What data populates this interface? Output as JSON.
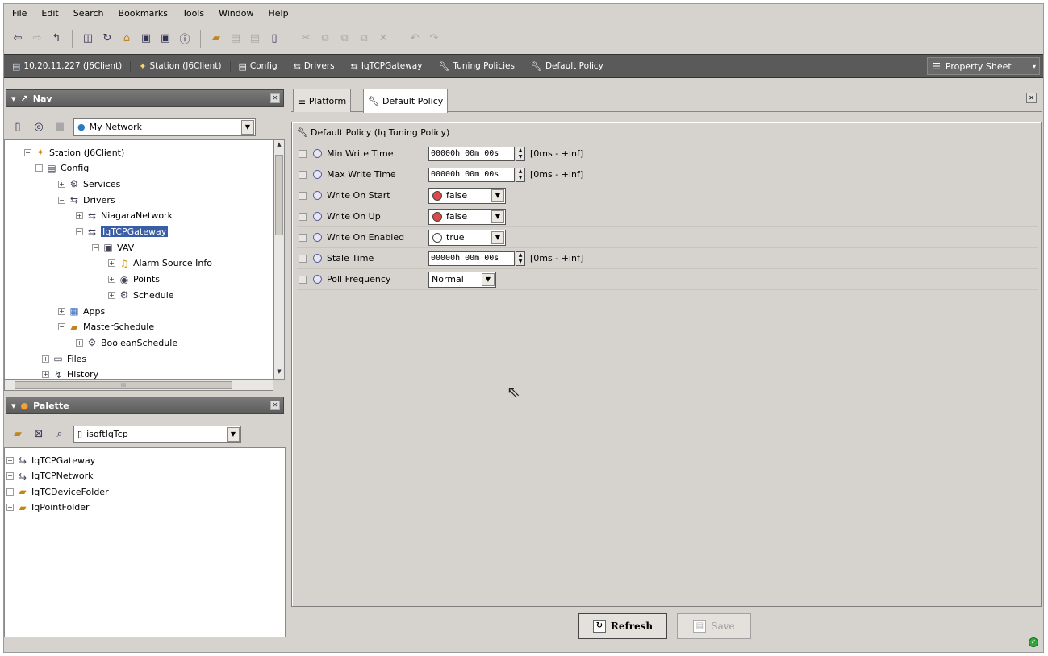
{
  "menu": [
    "File",
    "Edit",
    "Search",
    "Bookmarks",
    "Tools",
    "Window",
    "Help"
  ],
  "toolbar_icons": [
    "back-icon",
    "forward-icon",
    "up-icon",
    "side-bar-icon",
    "refresh-icon",
    "home-icon",
    "view-icon",
    "view-icon-2",
    "info-icon",
    "open-icon",
    "save-icon",
    "save-all-icon",
    "new-icon",
    "cut-icon",
    "copy-icon",
    "paste-icon",
    "duplicate-icon",
    "delete-icon",
    "undo-icon",
    "redo-icon"
  ],
  "locator": {
    "crumbs": [
      "10.20.11.227 (J6Client)",
      "Station (J6Client)",
      "Config",
      "Drivers",
      "IqTCPGateway",
      "Tuning Policies",
      "Default Policy"
    ],
    "view_selector": "Property Sheet"
  },
  "nav": {
    "title": "Nav",
    "network_selector": "My Network",
    "tree": [
      {
        "label": "Station (J6Client)",
        "icon": "station-icon",
        "exp": "−"
      },
      {
        "label": "Config",
        "icon": "config-icon",
        "exp": "−"
      },
      {
        "label": "Services",
        "icon": "services-icon",
        "exp": "+"
      },
      {
        "label": "Drivers",
        "icon": "drivers-icon",
        "exp": "−"
      },
      {
        "label": "NiagaraNetwork",
        "icon": "network-icon",
        "exp": "+"
      },
      {
        "label": "IqTCPGateway",
        "icon": "gateway-icon",
        "exp": "−",
        "selected": true
      },
      {
        "label": "VAV",
        "icon": "device-icon",
        "exp": "−"
      },
      {
        "label": "Alarm Source Info",
        "icon": "alarm-icon",
        "exp": "+"
      },
      {
        "label": "Points",
        "icon": "points-icon",
        "exp": "+"
      },
      {
        "label": "Schedule",
        "icon": "schedule-icon",
        "exp": "+"
      },
      {
        "label": "Apps",
        "icon": "apps-icon",
        "exp": "+"
      },
      {
        "label": "MasterSchedule",
        "icon": "folder-icon",
        "exp": "−"
      },
      {
        "label": "BooleanSchedule",
        "icon": "schedule-icon",
        "exp": "+"
      },
      {
        "label": "Files",
        "icon": "files-icon",
        "exp": "+"
      },
      {
        "label": "History",
        "icon": "history-icon",
        "exp": "+"
      }
    ],
    "hscroll_label": "III"
  },
  "palette": {
    "title": "Palette",
    "module_selector": "isoftIqTcp",
    "items": [
      {
        "label": "IqTCPGateway",
        "icon": "gateway-icon"
      },
      {
        "label": "IqTCPNetwork",
        "icon": "network-icon"
      },
      {
        "label": "IqTCDeviceFolder",
        "icon": "folder-icon"
      },
      {
        "label": "IqPointFolder",
        "icon": "folder-icon"
      }
    ]
  },
  "tabs": [
    "Platform",
    "Default Policy"
  ],
  "property_sheet": {
    "title": "Default Policy  (Iq Tuning Policy)",
    "rows": [
      {
        "name": "Min Write Time",
        "type": "reltime",
        "value": "00000h 00m 00s",
        "range": "[0ms - +inf]"
      },
      {
        "name": "Max Write Time",
        "type": "reltime",
        "value": "00000h 00m 00s",
        "range": "[0ms - +inf]"
      },
      {
        "name": "Write On Start",
        "type": "bool",
        "value": "false",
        "color": "#e04848"
      },
      {
        "name": "Write On Up",
        "type": "bool",
        "value": "false",
        "color": "#e04848"
      },
      {
        "name": "Write On Enabled",
        "type": "bool",
        "value": "true",
        "color": "#ffffff"
      },
      {
        "name": "Stale Time",
        "type": "reltime",
        "value": "00000h 00m 00s",
        "range": "[0ms - +inf]"
      },
      {
        "name": "Poll Frequency",
        "type": "enum",
        "value": "Normal"
      }
    ]
  },
  "buttons": {
    "refresh": "Refresh",
    "save": "Save"
  },
  "colors": {
    "locator_bg": "#5a5a5a",
    "selection": "#3a5ea6",
    "status_ok": "#2fa836"
  }
}
